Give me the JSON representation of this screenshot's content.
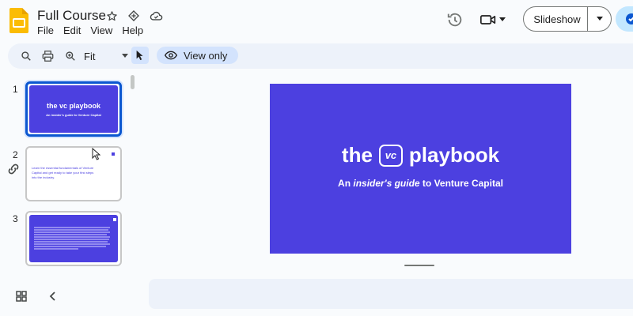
{
  "app": {
    "icon": "slides-logo-icon"
  },
  "header": {
    "doc_title": "Full Course",
    "menu": [
      "File",
      "Edit",
      "View",
      "Help"
    ],
    "slideshow_label": "Slideshow"
  },
  "toolbar": {
    "zoom_value": "Fit",
    "view_mode_label": "View only"
  },
  "filmstrip": {
    "slides": [
      {
        "number": "1",
        "title": "the vc playbook",
        "subtitle": "An insider's guide to Venture Capital"
      },
      {
        "number": "2",
        "text": "Learn the essential fundamentals of Venture Capital and get ready to take your first steps into the industry."
      },
      {
        "number": "3"
      }
    ]
  },
  "slide": {
    "title_left": "the",
    "title_badge": "vc",
    "title_right": "playbook",
    "subtitle_pre": "An ",
    "subtitle_italic": "insider's guide",
    "subtitle_post": " to Venture Capital"
  },
  "colors": {
    "slide_bg": "#4c40e0",
    "accent": "#0b57d0",
    "chip_bg": "#d3e3fd",
    "toolbar_bg": "#edf2fa"
  }
}
